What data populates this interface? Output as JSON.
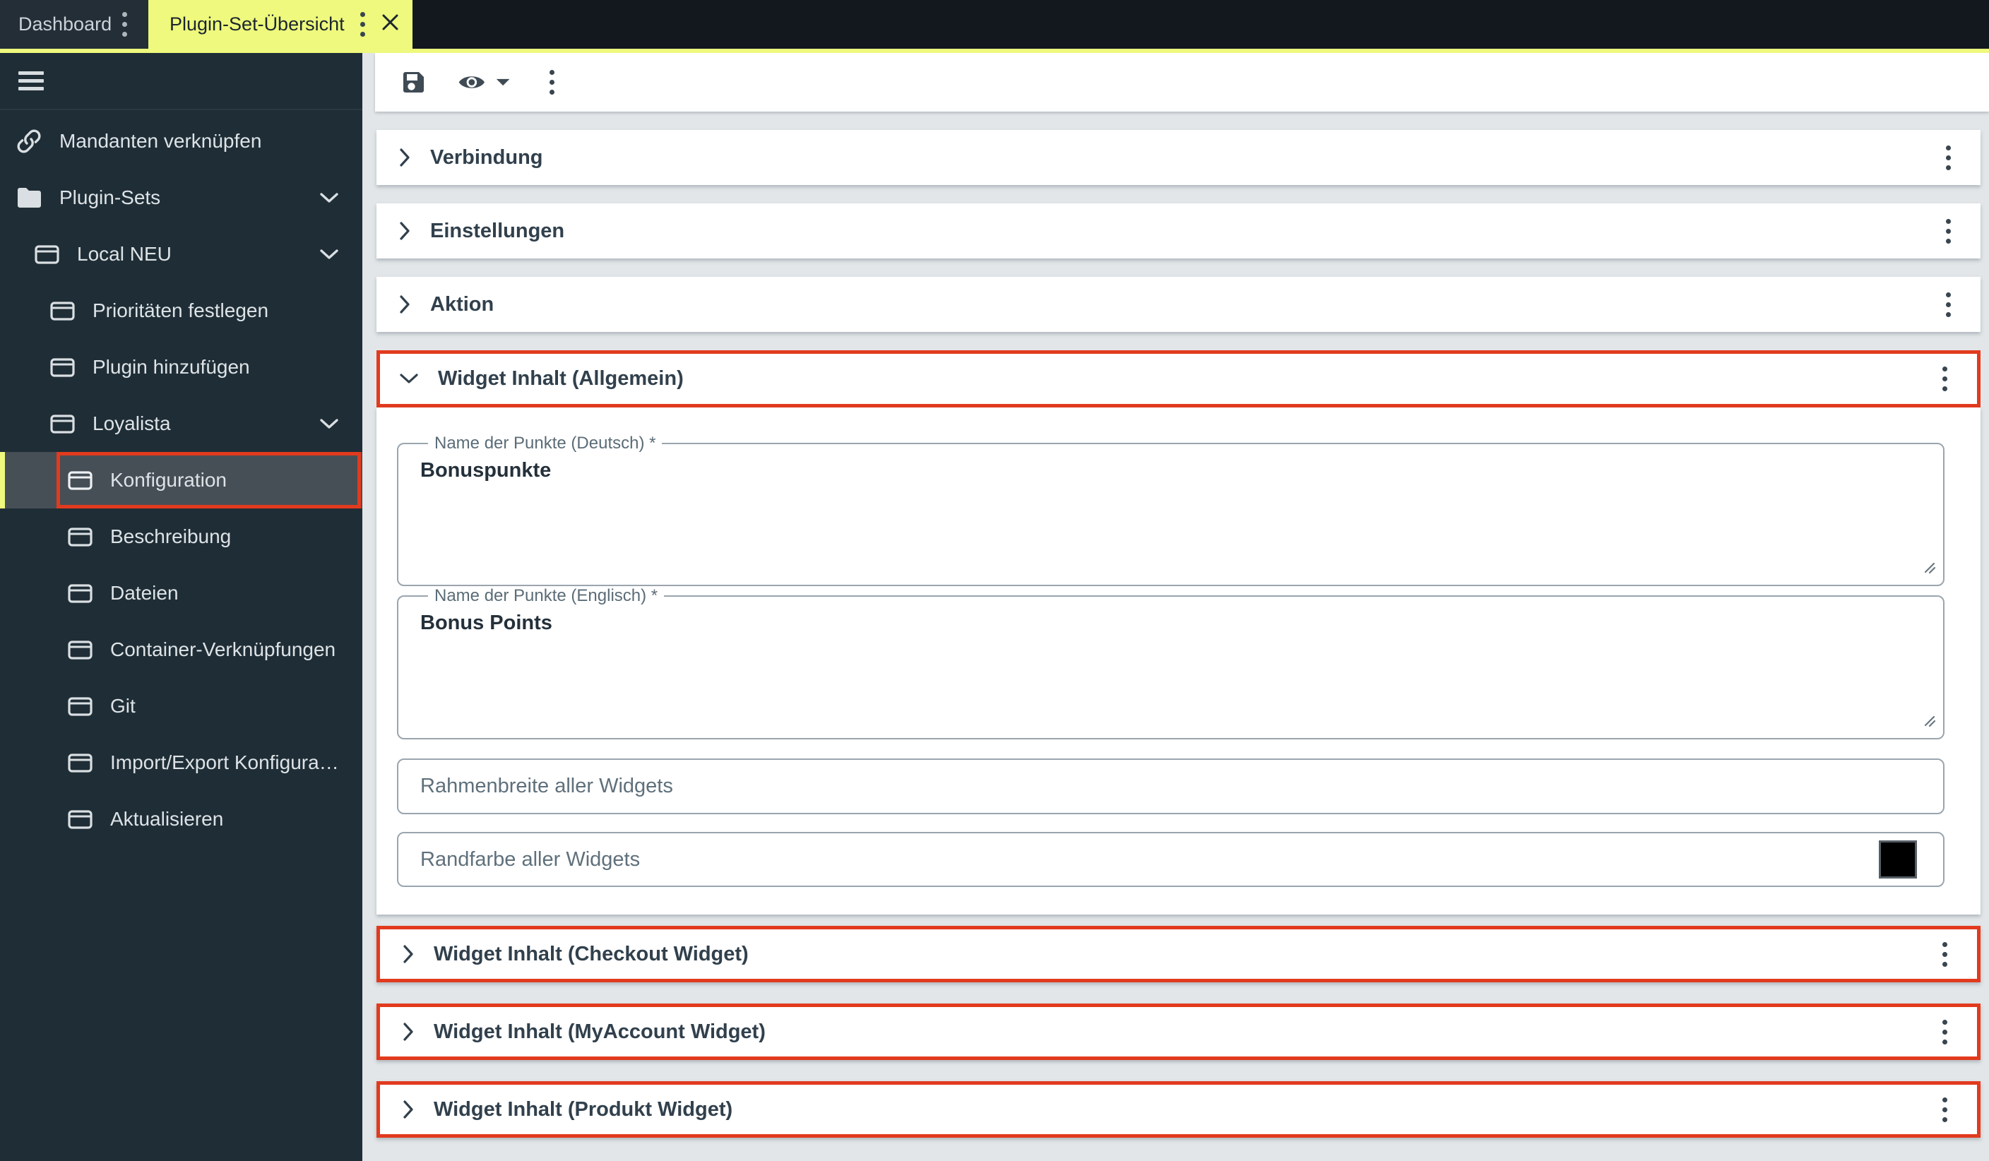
{
  "colors": {
    "accent_yellow": "#eef97d",
    "annotation_red": "#e23a1e",
    "sidebar_bg": "#1f2d36",
    "tabbar_bg": "#12181e",
    "main_bg": "#e2e6e8",
    "swatch_color": "#000000"
  },
  "tabbar": {
    "tabs": [
      {
        "label": "Dashboard",
        "active": false
      },
      {
        "label": "Plugin-Set-Übersicht",
        "active": true
      }
    ]
  },
  "sidebar": {
    "items": [
      {
        "label": "Mandanten verknüpfen",
        "icon": "link",
        "level": 0,
        "expandable": false,
        "selected": false
      },
      {
        "label": "Plugin-Sets",
        "icon": "folder",
        "level": 0,
        "expandable": true,
        "selected": false
      },
      {
        "label": "Local NEU",
        "icon": "window",
        "level": 1,
        "expandable": true,
        "selected": false
      },
      {
        "label": "Prioritäten festlegen",
        "icon": "window",
        "level": 2,
        "expandable": false,
        "selected": false
      },
      {
        "label": "Plugin hinzufügen",
        "icon": "window",
        "level": 2,
        "expandable": false,
        "selected": false
      },
      {
        "label": "Loyalista",
        "icon": "window",
        "level": 2,
        "expandable": true,
        "selected": false
      },
      {
        "label": "Konfiguration",
        "icon": "window",
        "level": 3,
        "expandable": false,
        "selected": true,
        "annotated": true
      },
      {
        "label": "Beschreibung",
        "icon": "window",
        "level": 3,
        "expandable": false,
        "selected": false
      },
      {
        "label": "Dateien",
        "icon": "window",
        "level": 3,
        "expandable": false,
        "selected": false
      },
      {
        "label": "Container-Verknüpfungen",
        "icon": "window",
        "level": 3,
        "expandable": false,
        "selected": false
      },
      {
        "label": "Git",
        "icon": "window",
        "level": 3,
        "expandable": false,
        "selected": false
      },
      {
        "label": "Import/Export Konfiguration…",
        "icon": "window",
        "level": 3,
        "expandable": false,
        "selected": false
      },
      {
        "label": "Aktualisieren",
        "icon": "window",
        "level": 3,
        "expandable": false,
        "selected": false
      }
    ]
  },
  "toolbar": {
    "icons": [
      "save-icon",
      "eye-preview-icon",
      "chevron-down-icon",
      "kebab-menu-icon"
    ]
  },
  "content": {
    "accordions": [
      {
        "title": "Verbindung",
        "state": "collapsed",
        "annotated": false
      },
      {
        "title": "Einstellungen",
        "state": "collapsed",
        "annotated": false
      },
      {
        "title": "Aktion",
        "state": "collapsed",
        "annotated": false
      },
      {
        "title": "Widget Inhalt (Allgemein)",
        "state": "expanded",
        "annotated": true
      },
      {
        "title": "Widget Inhalt (Checkout Widget)",
        "state": "collapsed",
        "annotated": true
      },
      {
        "title": "Widget Inhalt (MyAccount Widget)",
        "state": "collapsed",
        "annotated": true
      },
      {
        "title": "Widget Inhalt (Produkt Widget)",
        "state": "collapsed",
        "annotated": true
      }
    ],
    "form": {
      "fields": [
        {
          "type": "textarea",
          "label": "Name der Punkte (Deutsch) *",
          "value": "Bonuspunkte",
          "required": true
        },
        {
          "type": "textarea",
          "label": "Name der Punkte (Englisch) *",
          "value": "Bonus Points",
          "required": true
        },
        {
          "type": "text",
          "placeholder": "Rahmenbreite aller Widgets",
          "value": ""
        },
        {
          "type": "color",
          "label": "Randfarbe aller Widgets",
          "swatch_color": "#000000"
        }
      ]
    }
  }
}
